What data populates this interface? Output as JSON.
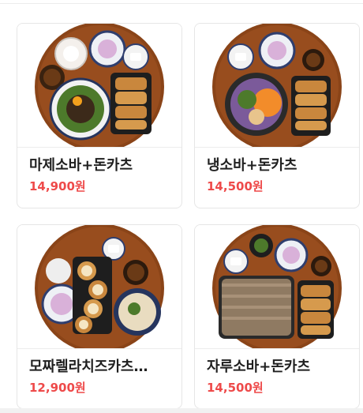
{
  "menu": {
    "items": [
      {
        "name": "마제소바+돈카츠",
        "price": "14,900원",
        "image": "mazesoba-donkatsu-photo"
      },
      {
        "name": "냉소바+돈카츠",
        "price": "14,500원",
        "image": "cold-soba-donkatsu-photo"
      },
      {
        "name": "모짜렐라치즈카츠…",
        "price": "12,900원",
        "image": "mozzarella-cheese-katsu-photo"
      },
      {
        "name": "자루소바+돈카츠",
        "price": "14,500원",
        "image": "zaru-soba-donkatsu-photo"
      }
    ]
  },
  "colors": {
    "price": "#ee4a4a",
    "tray": "#8a4418",
    "katsu": "#c9873d"
  }
}
